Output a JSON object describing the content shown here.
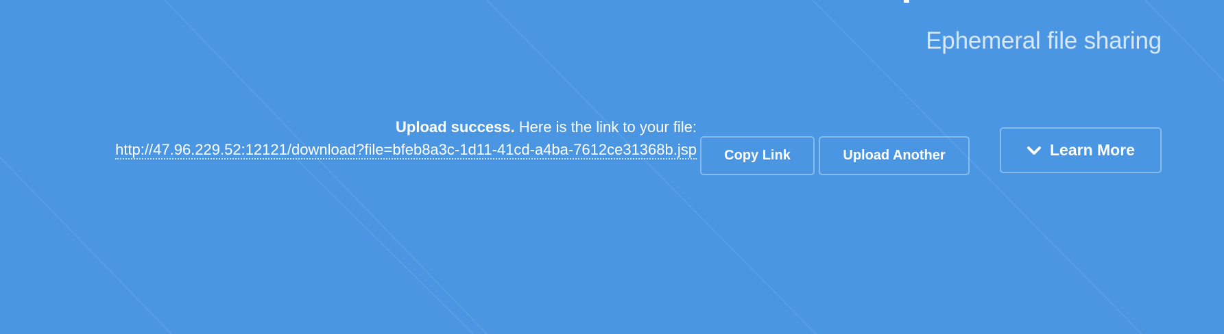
{
  "header": {
    "tagline": "Ephemeral file sharing"
  },
  "upload_result": {
    "status_bold": "Upload success.",
    "status_text": " Here is the link to your file:",
    "link": "http://47.96.229.52:12121/download?file=bfeb8a3c-1d11-41cd-a4ba-7612ce31368b.jsp"
  },
  "actions": {
    "copy_label": "Copy Link",
    "upload_another_label": "Upload Another",
    "learn_more_label": "Learn More",
    "learn_more_icon": "chevron-down-icon"
  },
  "colors": {
    "background": "#4a96e2",
    "tagline": "#d6e7f9",
    "text": "#ffffff"
  }
}
